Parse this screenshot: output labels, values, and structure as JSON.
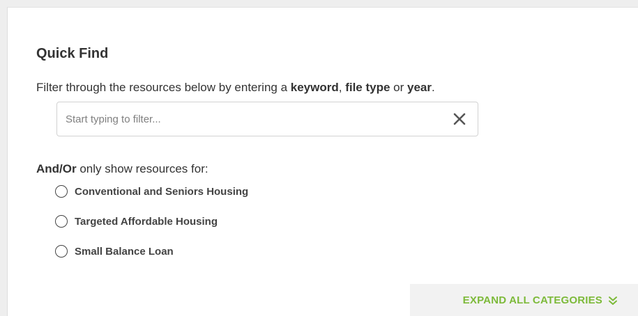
{
  "quick_find": {
    "title": "Quick Find",
    "description": {
      "prefix": "Filter through the resources below by entering a ",
      "keyword": "keyword",
      "comma": ", ",
      "file_type": "file type",
      "or": " or ",
      "year": "year",
      "period": "."
    },
    "search": {
      "placeholder": "Start typing to filter...",
      "value": ""
    },
    "clear_icon": "close-x-icon"
  },
  "filters": {
    "label_bold": "And/Or",
    "label_rest": " only show resources for:",
    "options": [
      {
        "label": "Conventional and Seniors Housing",
        "selected": false
      },
      {
        "label": "Targeted Affordable Housing",
        "selected": false
      },
      {
        "label": "Small Balance Loan",
        "selected": false
      }
    ]
  },
  "expand_all": {
    "label": "EXPAND ALL CATEGORIES",
    "icon": "double-chevron-down-icon",
    "color": "#7dba3a"
  },
  "colors": {
    "text": "#333333",
    "accent": "#7dba3a",
    "background": "#ffffff",
    "page": "#eeeeee"
  }
}
